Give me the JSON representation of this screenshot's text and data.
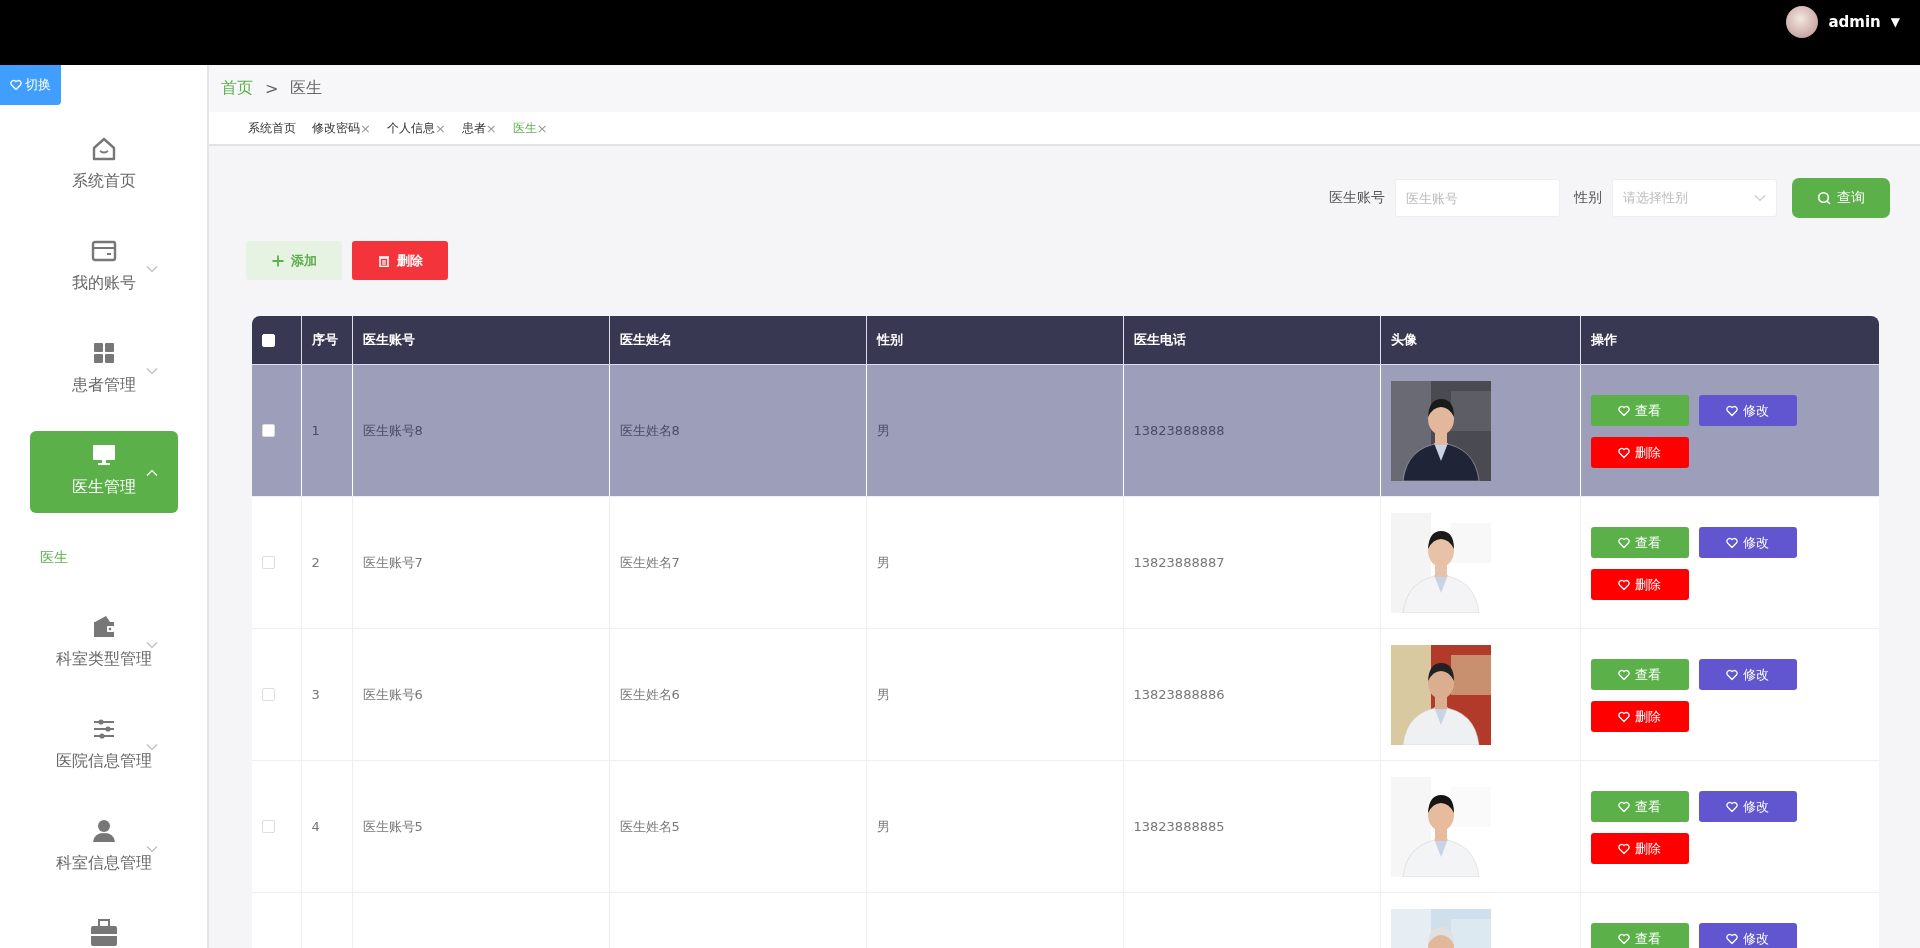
{
  "topbar": {
    "user": "admin",
    "menu_caret": "▼"
  },
  "sidebar": {
    "toggle": "切换",
    "items": [
      {
        "label": "系统首页",
        "kind": "link",
        "selected": false
      },
      {
        "label": "我的账号",
        "kind": "group",
        "expanded": false,
        "selected": false
      },
      {
        "label": "患者管理",
        "kind": "group",
        "expanded": false,
        "selected": false
      },
      {
        "label": "医生管理",
        "kind": "group",
        "expanded": true,
        "selected": true,
        "children": [
          {
            "label": "医生",
            "selected": true
          }
        ]
      },
      {
        "label": "科室类型管理",
        "kind": "group",
        "expanded": false,
        "selected": false
      },
      {
        "label": "医院信息管理",
        "kind": "group",
        "expanded": false,
        "selected": false
      },
      {
        "label": "科室信息管理",
        "kind": "group",
        "expanded": false,
        "selected": false
      },
      {
        "selected": false
      }
    ]
  },
  "breadcrumb": [
    {
      "label": "首页",
      "link": true
    },
    {
      "label": ">",
      "link": false
    },
    {
      "label": "医生",
      "link": false
    }
  ],
  "tabs": [
    {
      "label": "系统首页",
      "selected": false
    },
    {
      "label": "修改密码",
      "close": "×",
      "selected": false
    },
    {
      "label": "个人信息",
      "close": "×",
      "selected": false
    },
    {
      "label": "患者",
      "close": "×",
      "selected": false
    },
    {
      "label": "医生",
      "close": "×",
      "selected": true
    }
  ],
  "search": {
    "fields": [
      {
        "label": "医生账号",
        "kind": "input",
        "placeholder": "医生账号"
      },
      {
        "label": "性别",
        "kind": "select",
        "placeholder": "请选择性别"
      }
    ],
    "button": "查询"
  },
  "toolbar": [
    {
      "label": "添加",
      "kind": "add"
    },
    {
      "label": "删除",
      "kind": "delete"
    }
  ],
  "table": {
    "select_all": {
      "checked": false
    },
    "columns": [
      "序号",
      "医生账号",
      "医生姓名",
      "性别",
      "医生电话",
      "头像",
      "操作"
    ],
    "rows": [
      {
        "selected": true,
        "checked": false,
        "index": "1",
        "account": "医生账号8",
        "name": "医生姓名8",
        "gender": "男",
        "phone": "13823888888",
        "avatar": {
          "kind": "picture"
        },
        "actions": [
          {
            "label": "查看",
            "kind": "view"
          },
          {
            "label": "修改",
            "kind": "edit"
          },
          {
            "label": "删除",
            "kind": "delete"
          }
        ]
      },
      {
        "selected": false,
        "checked": false,
        "index": "2",
        "account": "医生账号7",
        "name": "医生姓名7",
        "gender": "男",
        "phone": "13823888887",
        "avatar": {
          "kind": "picture"
        },
        "actions": [
          {
            "label": "查看",
            "kind": "view"
          },
          {
            "label": "修改",
            "kind": "edit"
          },
          {
            "label": "删除",
            "kind": "delete"
          }
        ]
      },
      {
        "selected": false,
        "checked": false,
        "index": "3",
        "account": "医生账号6",
        "name": "医生姓名6",
        "gender": "男",
        "phone": "13823888886",
        "avatar": {
          "kind": "picture"
        },
        "actions": [
          {
            "label": "查看",
            "kind": "view"
          },
          {
            "label": "修改",
            "kind": "edit"
          },
          {
            "label": "删除",
            "kind": "delete"
          }
        ]
      },
      {
        "selected": false,
        "checked": false,
        "index": "4",
        "account": "医生账号5",
        "name": "医生姓名5",
        "gender": "男",
        "phone": "13823888885",
        "avatar": {
          "kind": "picture"
        },
        "actions": [
          {
            "label": "查看",
            "kind": "view"
          },
          {
            "label": "修改",
            "kind": "edit"
          },
          {
            "label": "删除",
            "kind": "delete"
          }
        ]
      },
      {
        "selected": false,
        "avatar": {
          "kind": "picture"
        },
        "actions": [
          {
            "label": "查看",
            "kind": "view"
          },
          {
            "label": "修改",
            "kind": "edit"
          }
        ]
      }
    ]
  }
}
